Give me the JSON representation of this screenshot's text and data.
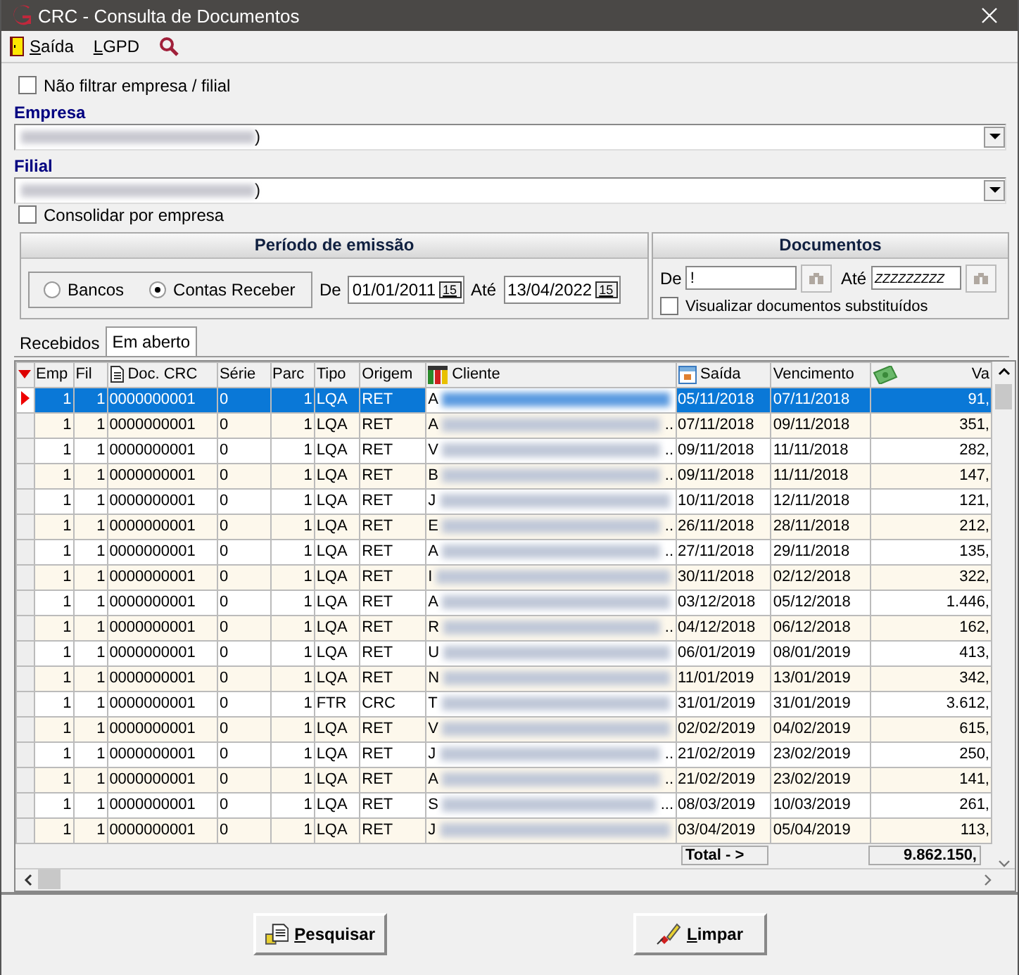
{
  "window": {
    "title": "CRC - Consulta de Documentos"
  },
  "toolbar": [
    {
      "kind": "exit",
      "label": "Saída"
    },
    {
      "kind": "text",
      "label": "LGPD"
    },
    {
      "kind": "search"
    }
  ],
  "filters": {
    "no_filter": {
      "label": "Não filtrar empresa / filial",
      "checked": false
    },
    "empresa": {
      "label": "Empresa",
      "value": ")"
    },
    "filial": {
      "label": "Filial",
      "value": ")"
    },
    "consolidar": {
      "label": "Consolidar por empresa",
      "checked": false
    }
  },
  "periodo": {
    "title": "Período de emissão",
    "radios": [
      {
        "label": "Bancos",
        "selected": false
      },
      {
        "label": "Contas Receber",
        "selected": true
      }
    ],
    "de_label": "De",
    "de": "01/01/2011",
    "ate_label": "Até",
    "ate": "13/04/2022",
    "de_calendar": "15",
    "ate_calendar": "15"
  },
  "documentos": {
    "title": "Documentos",
    "de_label": "De",
    "de": "!",
    "ate_label": "Até",
    "ate": "ZZZZZZZZZ",
    "substituidos": {
      "label": "Visualizar documentos substituídos",
      "checked": false
    }
  },
  "tabs": [
    {
      "label": "Recebidos",
      "selected": false
    },
    {
      "label": "Em aberto",
      "selected": true
    }
  ],
  "table": {
    "columns": [
      {
        "label": "Emp",
        "kind": "text"
      },
      {
        "label": "Fil",
        "kind": "text"
      },
      {
        "label": "Doc. CRC",
        "kind": "doc"
      },
      {
        "label": "Série",
        "kind": "text"
      },
      {
        "label": "Parc",
        "kind": "text"
      },
      {
        "label": "Tipo",
        "kind": "text"
      },
      {
        "label": "Origem",
        "kind": "text"
      },
      {
        "label": "Cliente",
        "kind": "client"
      },
      {
        "label": "Saída",
        "kind": "calendar"
      },
      {
        "label": "Vencimento",
        "kind": "text"
      },
      {
        "label": "Va",
        "kind": "money"
      }
    ],
    "rows": [
      {
        "selected": true,
        "cells": [
          "1",
          "1",
          "0000000001",
          "0",
          "1",
          "LQA",
          "RET"
        ],
        "client": "A",
        "tail": "",
        "saida": "05/11/2018",
        "venc": "07/11/2018",
        "valor": "91,"
      },
      {
        "selected": false,
        "cells": [
          "1",
          "1",
          "0000000001",
          "0",
          "1",
          "LQA",
          "RET"
        ],
        "client": "A",
        "tail": "..",
        "saida": "07/11/2018",
        "venc": "09/11/2018",
        "valor": "351,"
      },
      {
        "selected": false,
        "cells": [
          "1",
          "1",
          "0000000001",
          "0",
          "1",
          "LQA",
          "RET"
        ],
        "client": "V",
        "tail": "..",
        "saida": "09/11/2018",
        "venc": "11/11/2018",
        "valor": "282,"
      },
      {
        "selected": false,
        "cells": [
          "1",
          "1",
          "0000000001",
          "0",
          "1",
          "LQA",
          "RET"
        ],
        "client": "B",
        "tail": "..",
        "saida": "09/11/2018",
        "venc": "11/11/2018",
        "valor": "147,"
      },
      {
        "selected": false,
        "cells": [
          "1",
          "1",
          "0000000001",
          "0",
          "1",
          "LQA",
          "RET"
        ],
        "client": "J",
        "tail": "",
        "saida": "10/11/2018",
        "venc": "12/11/2018",
        "valor": "121,"
      },
      {
        "selected": false,
        "cells": [
          "1",
          "1",
          "0000000001",
          "0",
          "1",
          "LQA",
          "RET"
        ],
        "client": "E",
        "tail": "..",
        "saida": "26/11/2018",
        "venc": "28/11/2018",
        "valor": "212,"
      },
      {
        "selected": false,
        "cells": [
          "1",
          "1",
          "0000000001",
          "0",
          "1",
          "LQA",
          "RET"
        ],
        "client": "A",
        "tail": "..",
        "saida": "27/11/2018",
        "venc": "29/11/2018",
        "valor": "135,"
      },
      {
        "selected": false,
        "cells": [
          "1",
          "1",
          "0000000001",
          "0",
          "1",
          "LQA",
          "RET"
        ],
        "client": "I",
        "tail": "",
        "saida": "30/11/2018",
        "venc": "02/12/2018",
        "valor": "322,"
      },
      {
        "selected": false,
        "cells": [
          "1",
          "1",
          "0000000001",
          "0",
          "1",
          "LQA",
          "RET"
        ],
        "client": "A",
        "tail": "",
        "saida": "03/12/2018",
        "venc": "05/12/2018",
        "valor": "1.446,"
      },
      {
        "selected": false,
        "cells": [
          "1",
          "1",
          "0000000001",
          "0",
          "1",
          "LQA",
          "RET"
        ],
        "client": "R",
        "tail": "..",
        "saida": "04/12/2018",
        "venc": "06/12/2018",
        "valor": "162,"
      },
      {
        "selected": false,
        "cells": [
          "1",
          "1",
          "0000000001",
          "0",
          "1",
          "LQA",
          "RET"
        ],
        "client": "U",
        "tail": "",
        "saida": "06/01/2019",
        "venc": "08/01/2019",
        "valor": "413,"
      },
      {
        "selected": false,
        "cells": [
          "1",
          "1",
          "0000000001",
          "0",
          "1",
          "LQA",
          "RET"
        ],
        "client": "N",
        "tail": "",
        "saida": "11/01/2019",
        "venc": "13/01/2019",
        "valor": "342,"
      },
      {
        "selected": false,
        "cells": [
          "1",
          "1",
          "0000000001",
          "0",
          "1",
          "FTR",
          "CRC"
        ],
        "client": "T",
        "tail": "",
        "saida": "31/01/2019",
        "venc": "31/01/2019",
        "valor": "3.612,"
      },
      {
        "selected": false,
        "cells": [
          "1",
          "1",
          "0000000001",
          "0",
          "1",
          "LQA",
          "RET"
        ],
        "client": "V",
        "tail": "",
        "saida": "02/02/2019",
        "venc": "04/02/2019",
        "valor": "615,"
      },
      {
        "selected": false,
        "cells": [
          "1",
          "1",
          "0000000001",
          "0",
          "1",
          "LQA",
          "RET"
        ],
        "client": "J",
        "tail": "..",
        "saida": "21/02/2019",
        "venc": "23/02/2019",
        "valor": "250,"
      },
      {
        "selected": false,
        "cells": [
          "1",
          "1",
          "0000000001",
          "0",
          "1",
          "LQA",
          "RET"
        ],
        "client": "A",
        "tail": "..",
        "saida": "21/02/2019",
        "venc": "23/02/2019",
        "valor": "141,"
      },
      {
        "selected": false,
        "cells": [
          "1",
          "1",
          "0000000001",
          "0",
          "1",
          "LQA",
          "RET"
        ],
        "client": "S",
        "tail": "...",
        "saida": "08/03/2019",
        "venc": "10/03/2019",
        "valor": "261,"
      },
      {
        "selected": false,
        "cells": [
          "1",
          "1",
          "0000000001",
          "0",
          "1",
          "LQA",
          "RET"
        ],
        "client": "J",
        "tail": "",
        "saida": "03/04/2019",
        "venc": "05/04/2019",
        "valor": "113,"
      }
    ],
    "total_label": "Total - >",
    "total": "9.862.150,"
  },
  "buttons": [
    {
      "kind": "search",
      "label": "Pesquisar"
    },
    {
      "kind": "clear",
      "label": "Limpar"
    }
  ]
}
